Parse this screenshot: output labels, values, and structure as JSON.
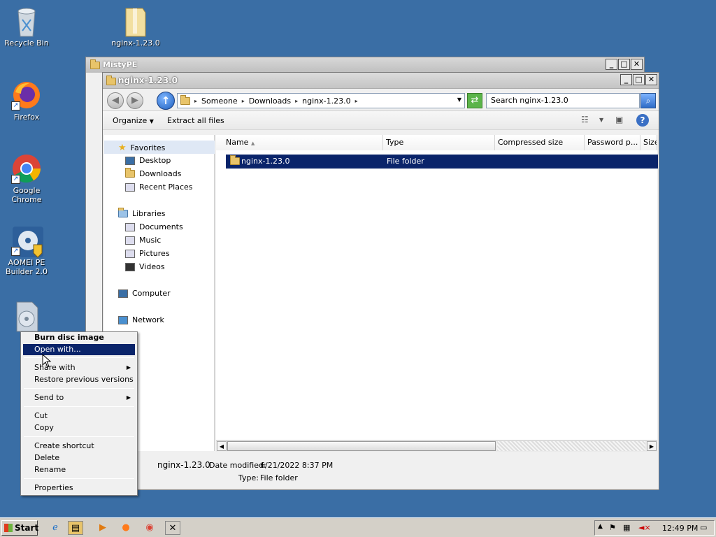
{
  "desktop": {
    "icons": [
      {
        "label": "Recycle Bin",
        "icon": "recycle-bin-icon"
      },
      {
        "label": "nginx-1.23.0",
        "icon": "zip-folder-icon"
      },
      {
        "label": "Firefox",
        "icon": "firefox-icon"
      },
      {
        "label": "Google Chrome",
        "icon": "chrome-icon"
      },
      {
        "label": "AOMEI PE",
        "label2": "Builder 2.0",
        "icon": "aomei-icon"
      }
    ]
  },
  "back_window": {
    "title": "MistyPE"
  },
  "window": {
    "title": "nginx-1.23.0",
    "controls": {
      "minimize": "_",
      "maximize": "□",
      "close": "✕"
    },
    "address": {
      "crumbs": [
        "Someone",
        "Downloads",
        "nginx-1.23.0"
      ]
    },
    "search_placeholder": "Search nginx-1.23.0",
    "toolbar": {
      "organize": "Organize",
      "extract": "Extract all files"
    },
    "nav": {
      "favorites": "Favorites",
      "desktop": "Desktop",
      "downloads": "Downloads",
      "recent": "Recent Places",
      "libraries": "Libraries",
      "documents": "Documents",
      "music": "Music",
      "pictures": "Pictures",
      "videos": "Videos",
      "computer": "Computer",
      "network": "Network"
    },
    "columns": [
      "Name",
      "Type",
      "Compressed size",
      "Password p...",
      "Size"
    ],
    "rows": [
      {
        "name": "nginx-1.23.0",
        "type": "File folder"
      }
    ],
    "details": {
      "name": "nginx-1.23.0",
      "modified_label": "Date modified:",
      "modified": "6/21/2022 8:37 PM",
      "type_label": "Type:",
      "type": "File folder"
    }
  },
  "context_menu": {
    "items": [
      {
        "label": "Burn disc image"
      },
      {
        "label": "Open with..."
      },
      {
        "label": "Share with"
      },
      {
        "label": "Restore previous versions"
      },
      {
        "label": "Send to"
      },
      {
        "label": "Cut"
      },
      {
        "label": "Copy"
      },
      {
        "label": "Create shortcut"
      },
      {
        "label": "Delete"
      },
      {
        "label": "Rename"
      },
      {
        "label": "Properties"
      }
    ]
  },
  "taskbar": {
    "start": "Start",
    "clock": "12:49 PM"
  },
  "colors": {
    "desktop": "#3a6ea5",
    "selection": "#0a246a"
  }
}
